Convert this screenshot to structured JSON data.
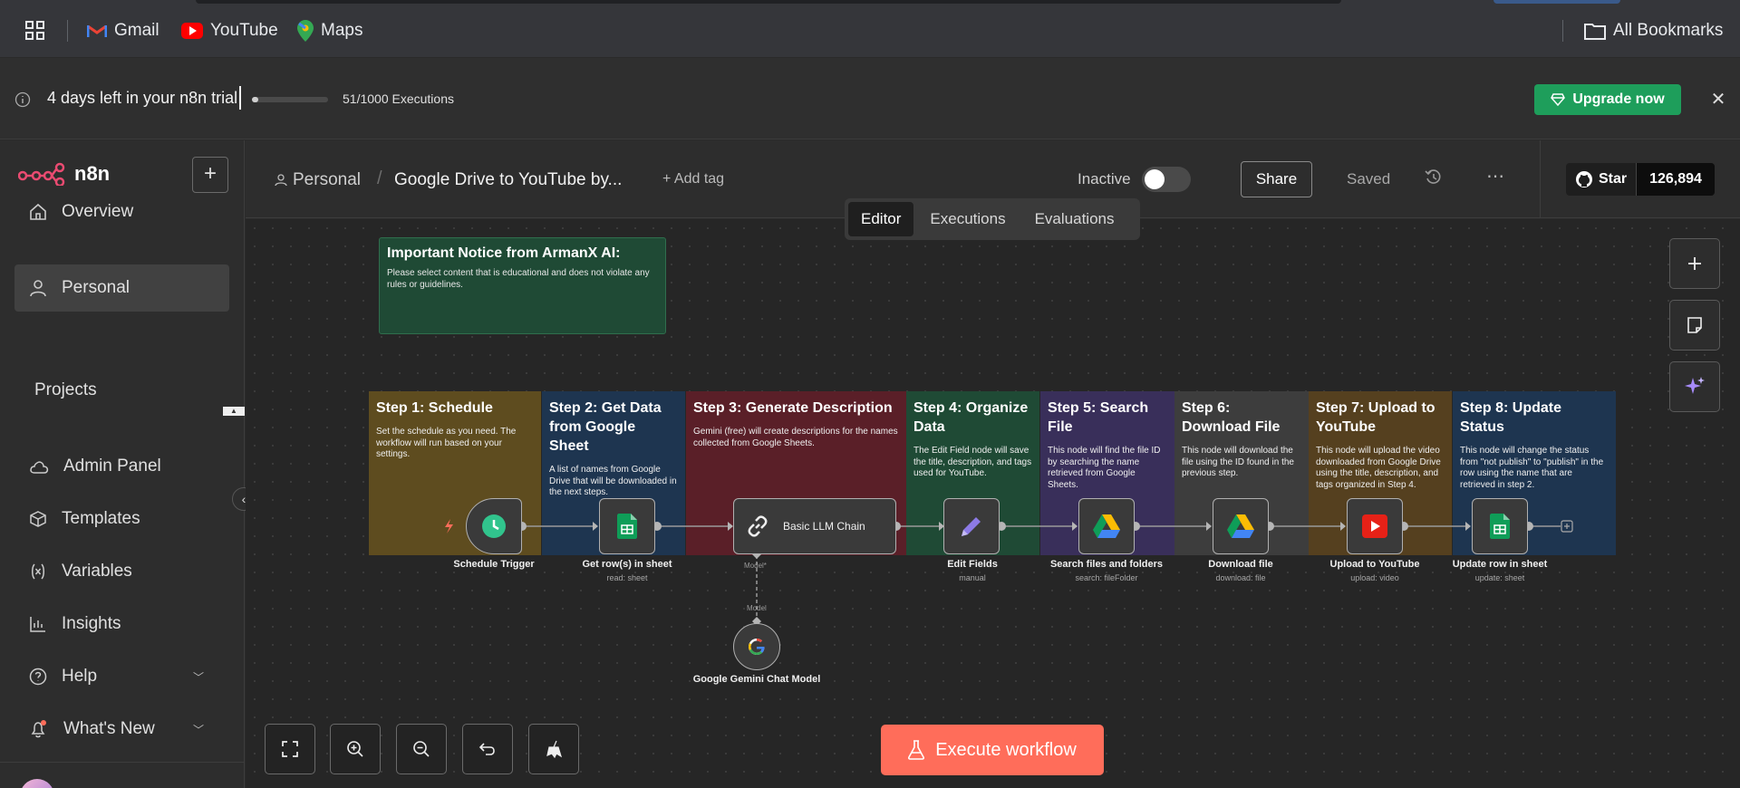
{
  "bookmarks": {
    "gmail": "Gmail",
    "youtube": "YouTube",
    "maps": "Maps",
    "all_bookmarks": "All Bookmarks"
  },
  "trial": {
    "message": "4 days left in your n8n trial",
    "executions": "51/1000 Executions",
    "progress": 0.051,
    "upgrade_label": "Upgrade now"
  },
  "sidebar": {
    "logo": "n8n",
    "items": [
      {
        "label": "Overview"
      },
      {
        "label": "Personal"
      }
    ],
    "projects_label": "Projects",
    "bottom_items": [
      {
        "label": "Admin Panel"
      },
      {
        "label": "Templates"
      },
      {
        "label": "Variables"
      },
      {
        "label": "Insights"
      },
      {
        "label": "Help"
      },
      {
        "label": "What's New"
      }
    ]
  },
  "header": {
    "breadcrumb_personal": "Personal",
    "breadcrumb_sep": "/",
    "workflow_title": "Google Drive to YouTube by...",
    "add_tag": "+ Add tag",
    "status": "Inactive",
    "share": "Share",
    "saved": "Saved",
    "github_star": "Star",
    "github_count": "126,894"
  },
  "tabs": [
    {
      "label": "Editor"
    },
    {
      "label": "Executions"
    },
    {
      "label": "Evaluations"
    }
  ],
  "notice": {
    "title": "Important Notice from ArmanX AI:",
    "body": "Please select content that is educational and does not violate any rules or guidelines."
  },
  "stickies": [
    {
      "title": "Step 1: Schedule",
      "body": "Set the schedule as you need. The workflow will run based on your settings.",
      "color": "#5e4c1f"
    },
    {
      "title": "Step 2: Get Data from Google Sheet",
      "body": "A list of names from Google Drive that will be downloaded in the next steps.",
      "color": "#1e3550"
    },
    {
      "title": "Step 3: Generate Description",
      "body": "Gemini (free) will create descriptions for the names collected from Google Sheets.",
      "color": "#5a1f28"
    },
    {
      "title": "Step 4: Organize Data",
      "body": "The Edit Field node will save the title, description, and tags used for YouTube.",
      "color": "#1f4a35"
    },
    {
      "title": "Step 5: Search File",
      "body": "This node will find the file ID by searching the name retrieved from Google Sheets.",
      "color": "#392f5a"
    },
    {
      "title": "Step 6: Download File",
      "body": "This node will download the file using the ID found in the previous step.",
      "color": "#3d3d3d"
    },
    {
      "title": "Step 7: Upload to YouTube",
      "body": "This node will upload the video downloaded from Google Drive using the title, description, and tags organized in Step 4.",
      "color": "#55401f"
    },
    {
      "title": "Step 8: Update Status",
      "body": "This node will change the status from \"not publish\" to \"publish\" in the row using the name that are retrieved in step 2.",
      "color": "#1e3550"
    }
  ],
  "nodes": [
    {
      "label": "Schedule Trigger",
      "sub": "",
      "icon": "clock-icon"
    },
    {
      "label": "Get row(s) in sheet",
      "sub": "read: sheet",
      "icon": "google-sheets-icon"
    },
    {
      "label": "Basic LLM Chain",
      "sub": "",
      "icon": "chain-link-icon"
    },
    {
      "label": "Edit Fields",
      "sub": "manual",
      "icon": "pencil-icon"
    },
    {
      "label": "Search files and folders",
      "sub": "search: fileFolder",
      "icon": "google-drive-icon"
    },
    {
      "label": "Download file",
      "sub": "download: file",
      "icon": "google-drive-icon"
    },
    {
      "label": "Upload to YouTube",
      "sub": "upload: video",
      "icon": "youtube-icon"
    },
    {
      "label": "Update row in sheet",
      "sub": "update: sheet",
      "icon": "google-sheets-icon"
    },
    {
      "label": "Google Gemini Chat Model",
      "sub": "",
      "icon": "google-icon"
    }
  ],
  "port_labels": {
    "model_top": "Model*",
    "model_bottom": "Model"
  },
  "execute_label": "Execute workflow",
  "colors": {
    "accent": "#ff6d5a",
    "upgrade": "#1e9e5b"
  }
}
